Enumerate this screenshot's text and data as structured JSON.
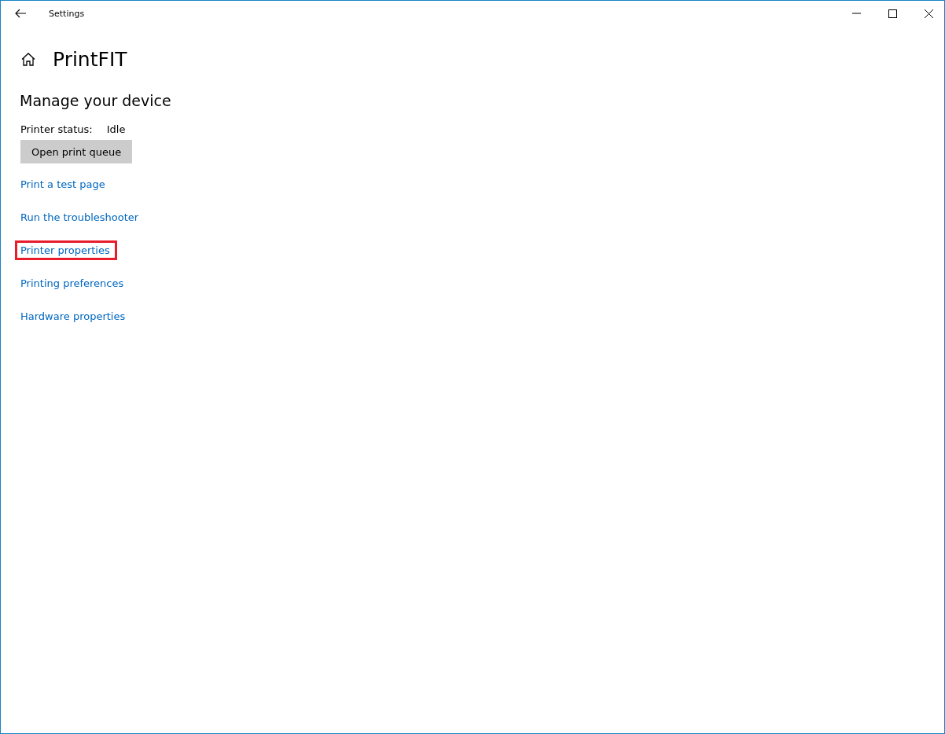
{
  "window": {
    "title": "Settings"
  },
  "page": {
    "title": "PrintFIT"
  },
  "section": {
    "heading": "Manage your device",
    "status_label": "Printer status:",
    "status_value": "Idle",
    "button": "Open print queue"
  },
  "links": [
    {
      "label": "Print a test page",
      "highlighted": false
    },
    {
      "label": "Run the troubleshooter",
      "highlighted": false
    },
    {
      "label": "Printer properties",
      "highlighted": true
    },
    {
      "label": "Printing preferences",
      "highlighted": false
    },
    {
      "label": "Hardware properties",
      "highlighted": false
    }
  ]
}
